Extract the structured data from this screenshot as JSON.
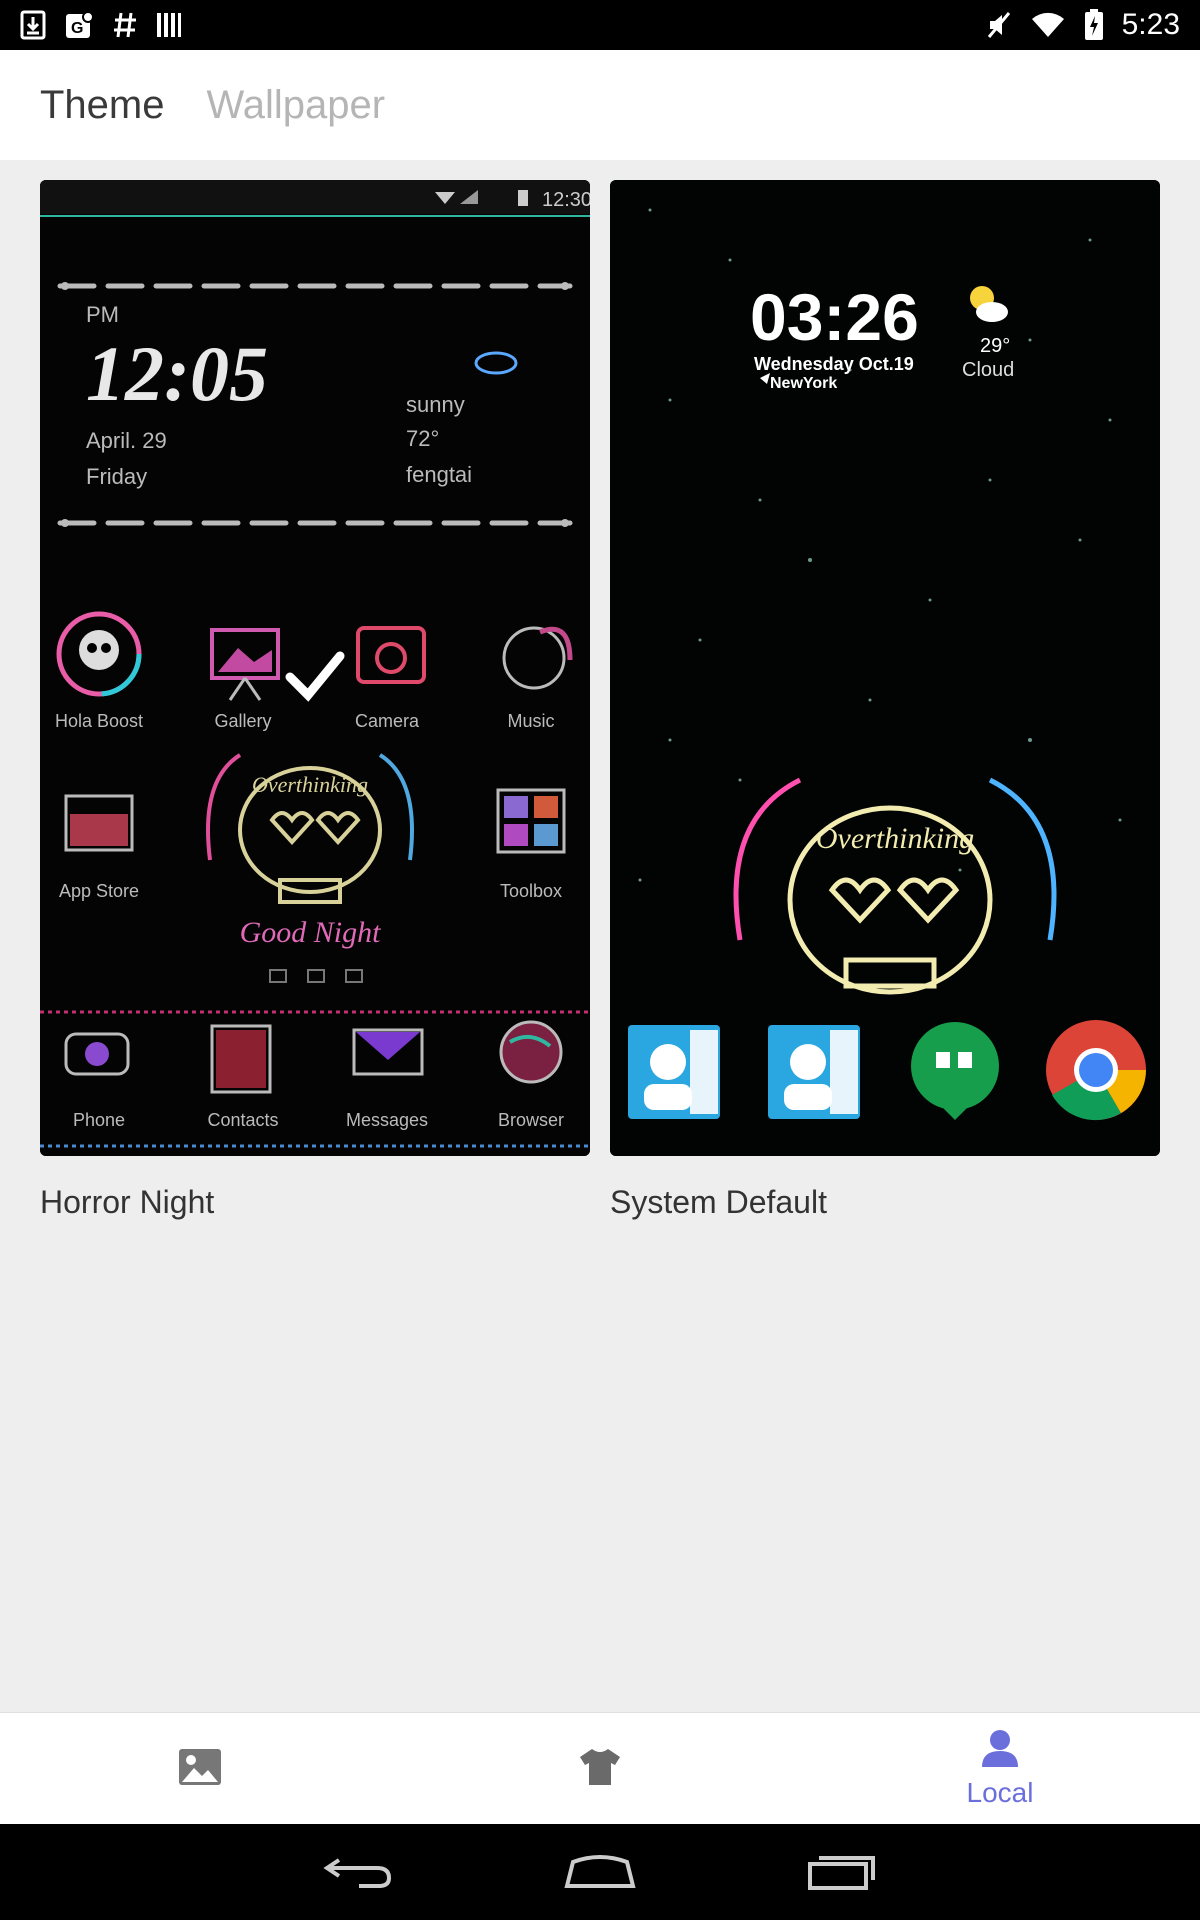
{
  "status_bar": {
    "time": "5:23"
  },
  "tabs": [
    {
      "label": "Theme",
      "active": true
    },
    {
      "label": "Wallpaper",
      "active": false
    }
  ],
  "themes": [
    {
      "name": "Horror Night",
      "selected": true,
      "preview": {
        "clock_ampm": "PM",
        "clock": "12:05",
        "status_time": "12:30",
        "date": "April. 29",
        "day": "Friday",
        "weather": "sunny",
        "temperature": "72°",
        "location": "fengtai",
        "apps": [
          "Hola Boost",
          "Gallery",
          "Camera",
          "Music",
          "App Store",
          "Toolbox"
        ],
        "dock": [
          "Phone",
          "Contacts",
          "Messages",
          "Browser"
        ],
        "sticker_text": "Overthinking",
        "sticker_sub": "Good Night"
      }
    },
    {
      "name": "System Default",
      "selected": false,
      "preview": {
        "clock": "03:26",
        "date": "Wednesday Oct.19",
        "location": "NewYork",
        "temperature": "29°",
        "weather": "Cloud",
        "sticker_text": "Overthinking"
      }
    }
  ],
  "bottom_nav": {
    "items": [
      {
        "icon": "image-icon",
        "label": ""
      },
      {
        "icon": "shirt-icon",
        "label": ""
      },
      {
        "icon": "person-icon",
        "label": "Local"
      }
    ],
    "accent": "#6b6fdb"
  }
}
